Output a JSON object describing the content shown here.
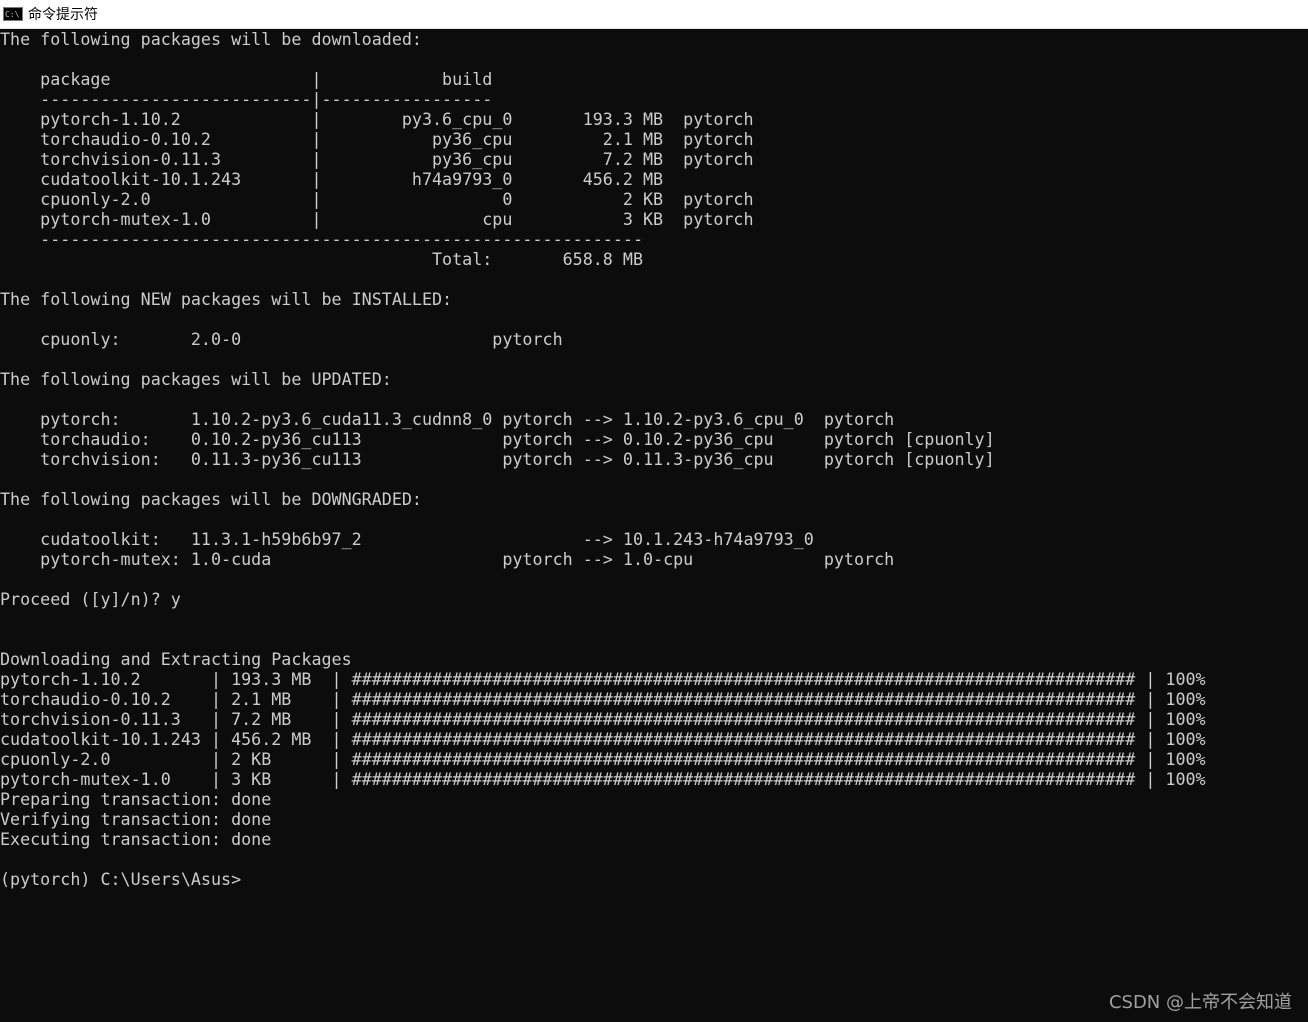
{
  "window": {
    "title": "命令提示符",
    "icon": "cmd-icon",
    "icon_text": "C:\\"
  },
  "console": {
    "lines": [
      "The following packages will be downloaded:",
      "",
      "    package                    |            build",
      "    ---------------------------|-----------------",
      "    pytorch-1.10.2             |        py3.6_cpu_0       193.3 MB  pytorch",
      "    torchaudio-0.10.2          |           py36_cpu         2.1 MB  pytorch",
      "    torchvision-0.11.3         |           py36_cpu         7.2 MB  pytorch",
      "    cudatoolkit-10.1.243       |         h74a9793_0       456.2 MB",
      "    cpuonly-2.0                |                  0           2 KB  pytorch",
      "    pytorch-mutex-1.0          |                cpu           3 KB  pytorch",
      "    ------------------------------------------------------------",
      "                                           Total:       658.8 MB",
      "",
      "The following NEW packages will be INSTALLED:",
      "",
      "    cpuonly:       2.0-0                         pytorch",
      "",
      "The following packages will be UPDATED:",
      "",
      "    pytorch:       1.10.2-py3.6_cuda11.3_cudnn8_0 pytorch --> 1.10.2-py3.6_cpu_0  pytorch",
      "    torchaudio:    0.10.2-py36_cu113              pytorch --> 0.10.2-py36_cpu     pytorch [cpuonly]",
      "    torchvision:   0.11.3-py36_cu113              pytorch --> 0.11.3-py36_cpu     pytorch [cpuonly]",
      "",
      "The following packages will be DOWNGRADED:",
      "",
      "    cudatoolkit:   11.3.1-h59b6b97_2                      --> 10.1.243-h74a9793_0",
      "    pytorch-mutex: 1.0-cuda                       pytorch --> 1.0-cpu             pytorch",
      "",
      "Proceed ([y]/n)? y",
      "",
      "",
      "Downloading and Extracting Packages",
      "pytorch-1.10.2       | 193.3 MB  | ############################################################################## | 100%",
      "torchaudio-0.10.2    | 2.1 MB    | ############################################################################## | 100%",
      "torchvision-0.11.3   | 7.2 MB    | ############################################################################## | 100%",
      "cudatoolkit-10.1.243 | 456.2 MB  | ############################################################################## | 100%",
      "cpuonly-2.0          | 2 KB      | ############################################################################## | 100%",
      "pytorch-mutex-1.0    | 3 KB      | ############################################################################## | 100%",
      "Preparing transaction: done",
      "Verifying transaction: done",
      "Executing transaction: done",
      "",
      "(pytorch) C:\\Users\\Asus>"
    ]
  },
  "watermark": "CSDN @上帝不会知道",
  "colors": {
    "background": "#0c0c0c",
    "text": "#cccccc"
  }
}
